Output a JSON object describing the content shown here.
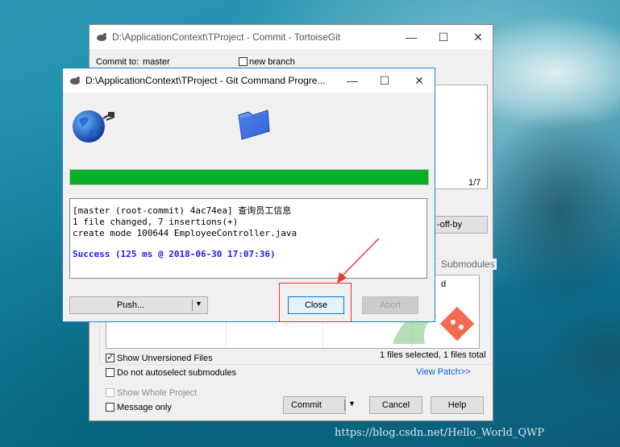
{
  "commit_window": {
    "title": "D:\\ApplicationContext\\TProject - Commit - TortoiseGit",
    "commit_to_label": "Commit to:",
    "branch": "master",
    "new_branch_label": "new branch",
    "counter": "1/7",
    "signoff_label": "-off-by",
    "submodules_label": "Submodules",
    "d_label": "d",
    "show_unversioned_label": "Show Unversioned Files",
    "no_autoselect_label": "Do not autoselect submodules",
    "files_selected": "1 files selected, 1 files total",
    "view_patch": "View Patch>>",
    "show_whole_project": "Show Whole Project",
    "message_only": "Message only",
    "commit_label": "Commit",
    "cancel_label": "Cancel",
    "help_label": "Help"
  },
  "progress_window": {
    "title": "D:\\ApplicationContext\\TProject - Git Command Progre...",
    "progress_fraction": 1.0,
    "log_lines": [
      "[master (root-commit) 4ac74ea] 查询员工信息",
      " 1 file changed, 7 insertions(+)",
      " create mode 100644 EmployeeController.java",
      "Success (125 ms @ 2018-06-30 17:07:36)"
    ],
    "push_label": "Push...",
    "close_label": "Close",
    "abort_label": "Abort"
  },
  "watermark": "https://blog.csdn.net/Hello_World_QWP",
  "colors": {
    "progress": "#06b025",
    "success": "#1a1aff",
    "annotation": "#e53935"
  },
  "icons": [
    "tortoisegit-icon",
    "globe-icon",
    "folder-icon",
    "minimize-icon",
    "maximize-icon",
    "close-icon",
    "dropdown-arrow-icon",
    "red-arrow"
  ]
}
